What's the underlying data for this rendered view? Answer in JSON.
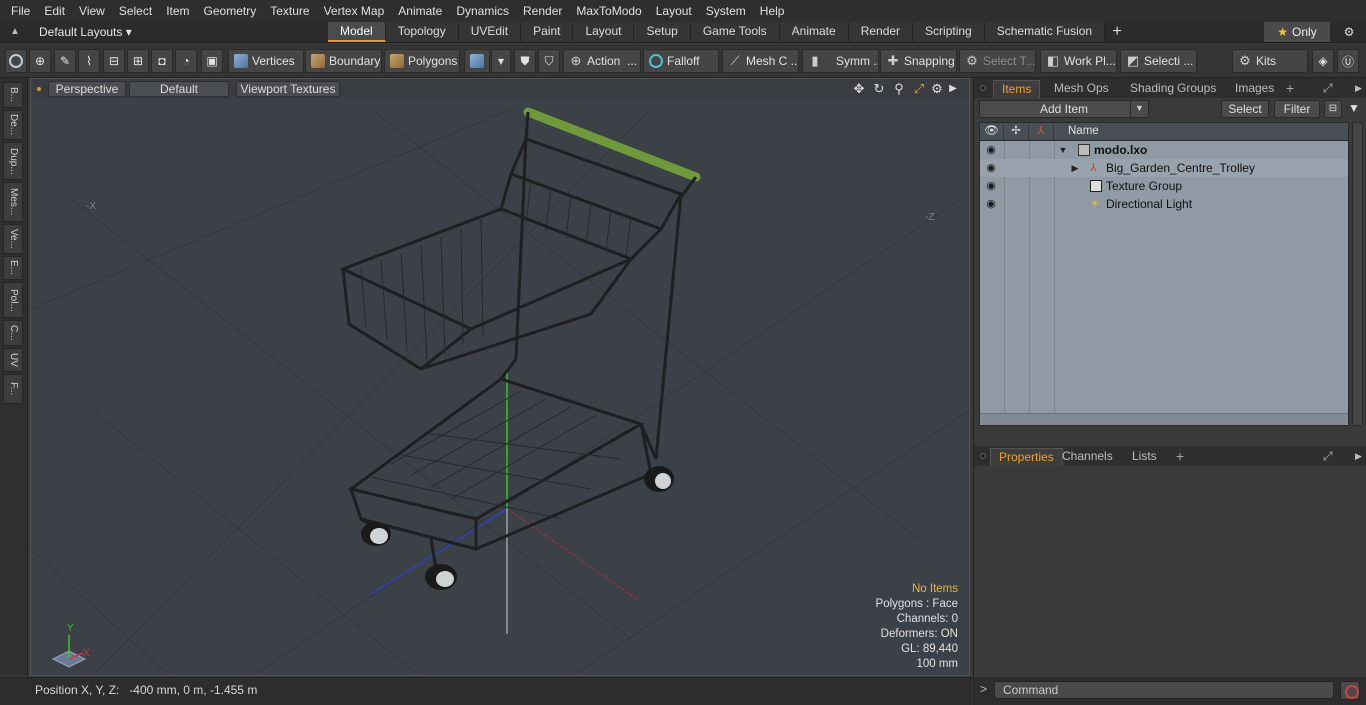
{
  "menubar": {
    "items": [
      "File",
      "Edit",
      "View",
      "Select",
      "Item",
      "Geometry",
      "Texture",
      "Vertex Map",
      "Animate",
      "Dynamics",
      "Render",
      "MaxToModo",
      "Layout",
      "System",
      "Help"
    ]
  },
  "layoutbar": {
    "layouts_label": "Default Layouts",
    "tabs": [
      "Model",
      "Topology",
      "UVEdit",
      "Paint",
      "Layout",
      "Setup",
      "Game Tools",
      "Animate",
      "Render",
      "Scripting",
      "Schematic Fusion"
    ],
    "active_tab": "Model",
    "add_tab": "+",
    "only_label": "Only"
  },
  "toolbar": {
    "vertices": "Vertices",
    "boundary": "Boundary",
    "polygons": "Polygons",
    "action": "Action",
    "falloff": "Falloff",
    "mesh_c": "Mesh C ...",
    "symm": "Symm ...",
    "snapping": "Snapping",
    "select_t": "Select T...",
    "work_pl": "Work Pl...",
    "selecti": "Selecti ...",
    "kits": "Kits"
  },
  "lefttabs": [
    "B...",
    "De...",
    "Dup...",
    "Mes...",
    "Ve...",
    "E...",
    "Pol...",
    "C...",
    "UV",
    "F..."
  ],
  "viewport": {
    "view_mode": "Perspective",
    "shading": "Default",
    "textures": "Viewport Textures",
    "axis_neg_x": "-X",
    "axis_neg_z": "-Z",
    "info": {
      "selection": "No Items",
      "polygons": "Polygons : Face",
      "channels": "Channels: 0",
      "deformers": "Deformers: ON",
      "gl": "GL: 89,440",
      "grid": "100 mm"
    },
    "gizmo": {
      "x": "X",
      "y": "Y"
    }
  },
  "statusbar": {
    "position": "Position X, Y, Z:   -400 mm, 0 m, -1.455 m"
  },
  "items_panel": {
    "tabs": [
      "Items",
      "Mesh Ops",
      "Shading",
      "Groups",
      "Images"
    ],
    "active_tab": "Items",
    "add_item": "Add Item",
    "select": "Select",
    "filter": "Filter",
    "column_name": "Name",
    "items": [
      {
        "label": "modo.lxo",
        "depth": 0,
        "expanded": true,
        "icon": "scene-icon",
        "bold": true
      },
      {
        "label": "Big_Garden_Centre_Trolley",
        "depth": 1,
        "expanded": false,
        "icon": "mesh-icon",
        "bold": false
      },
      {
        "label": "Texture Group",
        "depth": 1,
        "expanded": null,
        "icon": "texture-group-icon",
        "bold": false
      },
      {
        "label": "Directional Light",
        "depth": 1,
        "expanded": null,
        "icon": "light-icon",
        "bold": false
      }
    ]
  },
  "properties_panel": {
    "tabs": [
      "Properties",
      "Channels",
      "Lists"
    ],
    "active_tab": "Properties"
  },
  "command": {
    "prompt": ">",
    "placeholder": "Command"
  },
  "colors": {
    "accent": "#e59a2b",
    "viewport_bg": "#3c4148",
    "list_bg": "#8f9aa5",
    "trolley_handle": "#6e9a3a"
  }
}
